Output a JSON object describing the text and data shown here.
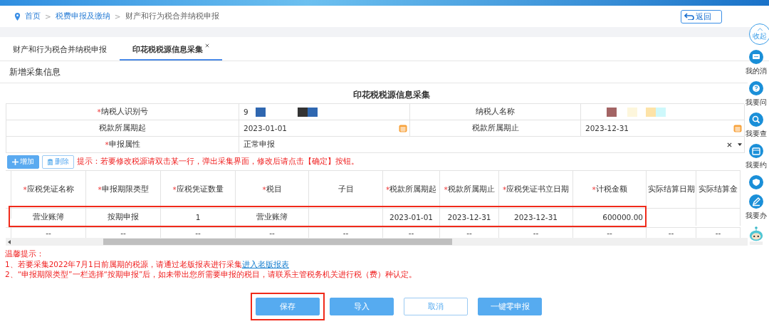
{
  "breadcrumb": [
    {
      "label": "首页",
      "link": true
    },
    {
      "label": "税费申报及缴纳",
      "link": true
    },
    {
      "label": "财产和行为税合并纳税申报",
      "link": false
    }
  ],
  "breadcrumb_separator": ">",
  "required_mark": "*",
  "back_button": "返回",
  "tabs": [
    {
      "label": "财产和行为税合并纳税申报",
      "selected": false,
      "closable": false
    },
    {
      "label": "印花税税源信息采集",
      "selected": true,
      "closable": true
    }
  ],
  "section_title": "新增采集信息",
  "form": {
    "title": "印花税税源信息采集",
    "fields": [
      {
        "label": "纳税人识别号",
        "required": true,
        "value": "9",
        "kind": "redacted"
      },
      {
        "label": "纳税人名称",
        "required": false,
        "kind": "redacted"
      },
      {
        "label": "税款所属期起",
        "required": false,
        "value": "2023-01-01",
        "kind": "date"
      },
      {
        "label": "税款所属期止",
        "required": false,
        "value": "2023-12-31",
        "kind": "date"
      },
      {
        "label": "申报属性",
        "required": true,
        "value": "正常申报",
        "kind": "select"
      }
    ]
  },
  "toolbar": {
    "buttons": [
      {
        "label": "增加",
        "kind": "primary"
      },
      {
        "label": "删除",
        "kind": "outline"
      }
    ],
    "hint": "提示：若要修改税源请双击某一行，弹出采集界面，修改后请点击【确定】按钮。"
  },
  "table": {
    "columns": [
      {
        "label": "应税凭证名称",
        "required": true
      },
      {
        "label": "申报期限类型",
        "required": true
      },
      {
        "label": "应税凭证数量",
        "required": true
      },
      {
        "label": "税目",
        "required": true
      },
      {
        "label": "子目",
        "required": false
      },
      {
        "label": "税款所属期起",
        "required": true
      },
      {
        "label": "税款所属期止",
        "required": true
      },
      {
        "label": "应税凭证书立日期",
        "required": true
      },
      {
        "label": "计税金额",
        "required": true
      },
      {
        "label": "实际结算日期",
        "required": false
      },
      {
        "label": "实际结算金",
        "required": false
      }
    ],
    "rows": [
      {
        "highlighted": true,
        "cells": [
          "营业账簿",
          "按期申报",
          "1",
          "营业账簿",
          null,
          "2023-01-01",
          "2023-12-31",
          "2023-12-31",
          "600000.00",
          null,
          null
        ]
      },
      {
        "highlighted": false,
        "cells": [
          "--",
          "--",
          "--",
          "--",
          "--",
          "--",
          "--",
          "--",
          "--",
          "--",
          "--"
        ]
      }
    ]
  },
  "notice": {
    "title": "温馨提示：",
    "items": [
      {
        "text": "1、若要采集2022年7月1日前属期的税源，请通过老版报表进行采集",
        "link": "进入老版报表"
      },
      {
        "text": "2、“申报期限类型”一栏选择“按期申报”后，如未带出您所需要申报的税目，请联系主管税务机关进行税（费）种认定。"
      }
    ]
  },
  "actions": [
    {
      "label": "保存",
      "kind": "primary",
      "highlighted": true
    },
    {
      "label": "导入",
      "kind": "primary",
      "highlighted": false
    },
    {
      "label": "取消",
      "kind": "outline",
      "highlighted": false
    },
    {
      "label": "一键零申报",
      "kind": "primary",
      "highlighted": false
    }
  ],
  "float_menu": {
    "collapse": "收起",
    "items": [
      {
        "kind": "chat",
        "label": "我的消"
      },
      {
        "kind": "question",
        "label": "我要问"
      },
      {
        "kind": "search",
        "label": "我要查"
      },
      {
        "kind": "calendar",
        "label": "我要约"
      },
      {
        "kind": "shield"
      },
      {
        "kind": "edit",
        "label": "我要办"
      },
      {
        "kind": "robot"
      }
    ]
  }
}
